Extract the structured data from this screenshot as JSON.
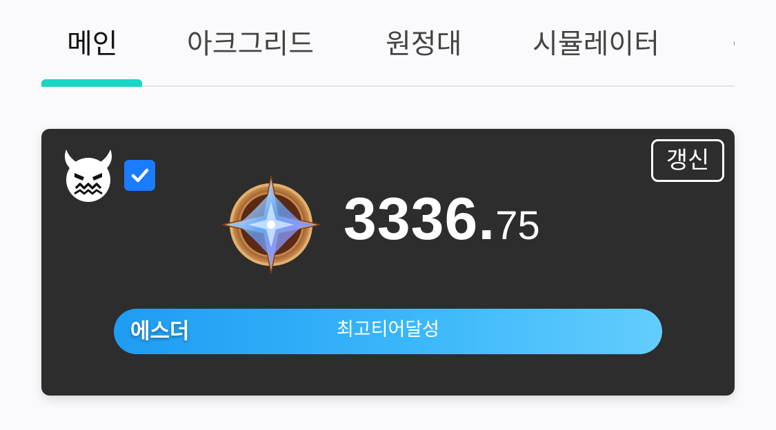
{
  "tabs": [
    {
      "label": "메인",
      "active": true
    },
    {
      "label": "아크그리드",
      "active": false
    },
    {
      "label": "원정대",
      "active": false
    },
    {
      "label": "시뮬레이터",
      "active": false
    }
  ],
  "card": {
    "avatar_icon": "demon-face-icon",
    "checkbox_checked": true,
    "refresh_label": "갱신",
    "emblem_icon": "star-crystal-emblem-icon",
    "score_integer": "3336.",
    "score_decimal": "75",
    "tier_name": "에스더",
    "tier_status": "최고티어달성"
  },
  "colors": {
    "accent": "#1ad6c4",
    "card_bg": "#2d2d2d",
    "checkbox": "#1a7cff",
    "tier_bar_start": "#1e9cf2",
    "tier_bar_end": "#63cdfd"
  }
}
